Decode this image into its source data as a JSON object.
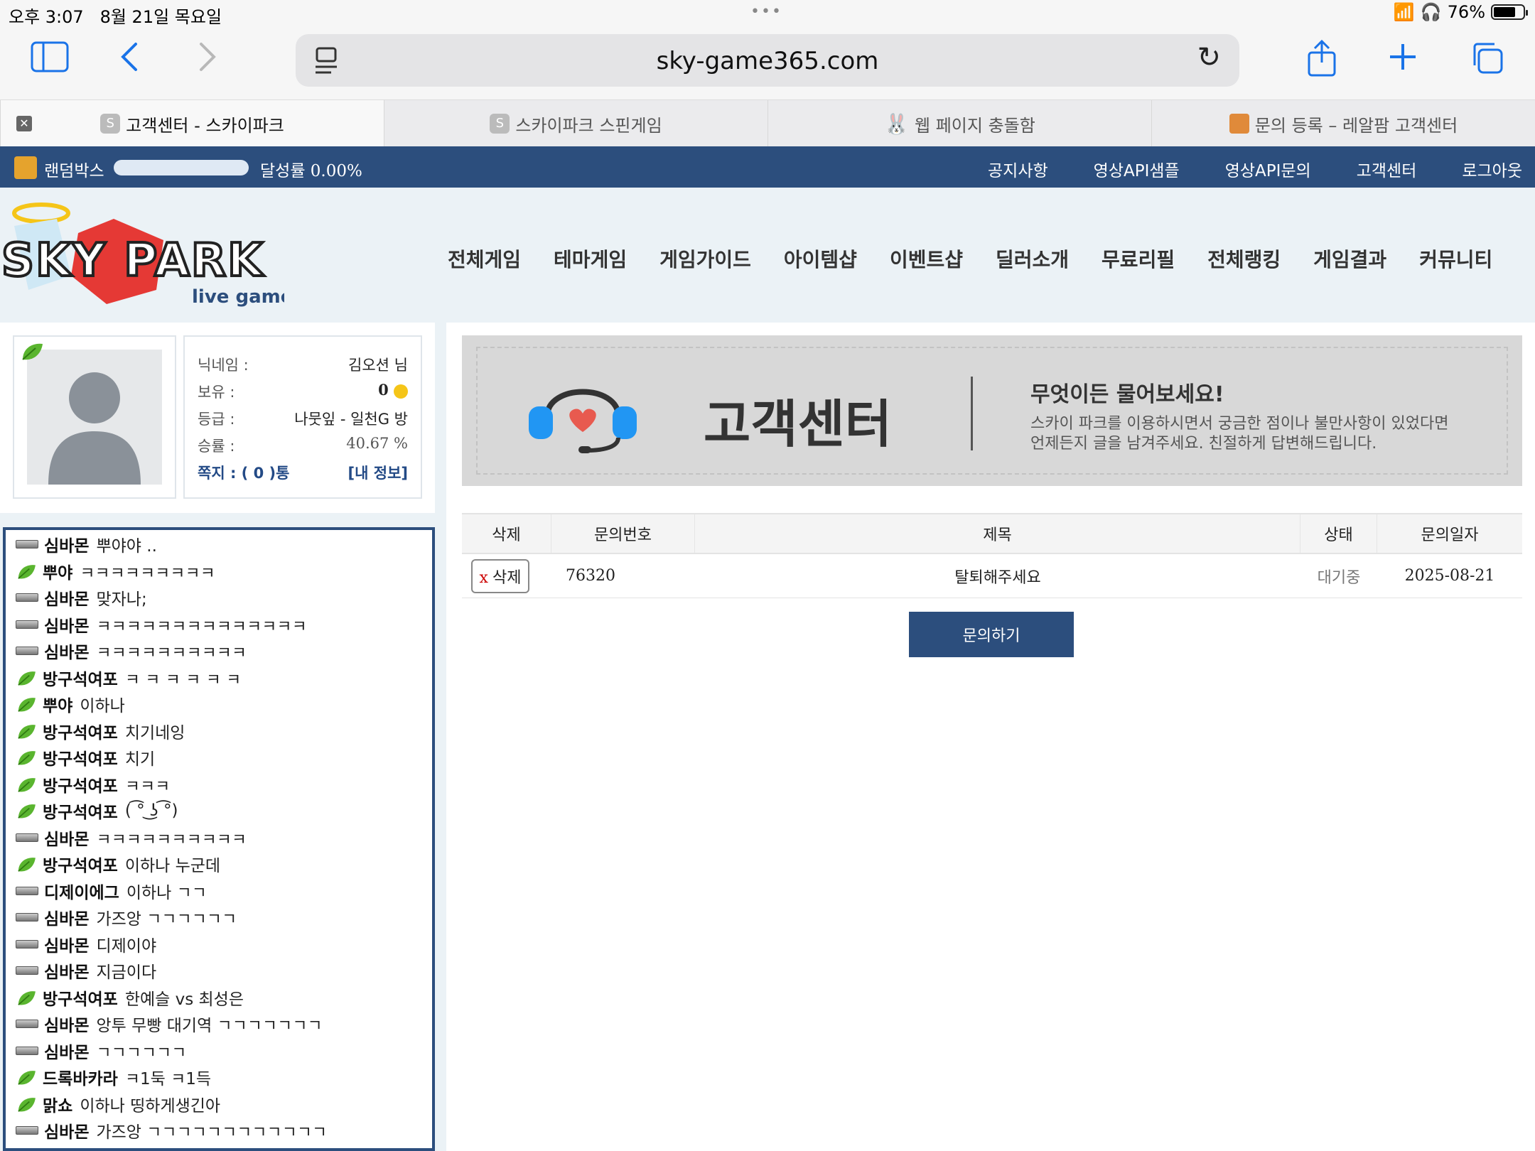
{
  "status_bar": {
    "time": "오후 3:07",
    "date": "8월 21일 목요일",
    "battery": "76%",
    "battery_level": 0.76
  },
  "browser": {
    "url": "sky-game365.com",
    "tabs": [
      {
        "title": "고객센터 - 스카이파크",
        "favicon": "S",
        "active": true
      },
      {
        "title": "스카이파크 스핀게임",
        "favicon": "S",
        "active": false
      },
      {
        "title": "웹 페이지 충돌함",
        "favicon": "",
        "active": false
      },
      {
        "title": "문의 등록 – 레알팜 고객센터",
        "favicon": "",
        "active": false
      }
    ]
  },
  "topbar": {
    "randombox_label": "랜덤박스",
    "progress": 0.0,
    "rate_label": "달성률 0.00%",
    "links": [
      "공지사항",
      "영상API샘플",
      "영상API문의",
      "고객센터",
      "로그아웃"
    ]
  },
  "logo": {
    "text": "SKY PARK",
    "subtitle": "live games"
  },
  "nav": [
    "전체게임",
    "테마게임",
    "게임가이드",
    "아이템샵",
    "이벤트샵",
    "딜러소개",
    "무료리필",
    "전체랭킹",
    "게임결과",
    "커뮤니티"
  ],
  "profile": {
    "nickname_label": "닉네임 :",
    "nickname": "김오션 님",
    "balance_label": "보유 :",
    "balance": "0",
    "grade_label": "등급 :",
    "grade": "나뭇잎 - 일천G 방",
    "winrate_label": "승률 :",
    "winrate": "40.67 %",
    "messages": "쪽지 : ( 0 )통",
    "myinfo": "[내 정보]"
  },
  "chat": [
    {
      "level": "bar",
      "nick": "심바몬",
      "msg": "뿌야야 .."
    },
    {
      "level": "leaf",
      "nick": "뿌야",
      "msg": "ㅋㅋㅋㅋㅋㅋㅋㅋㅋ"
    },
    {
      "level": "bar",
      "nick": "심바몬",
      "msg": "맞자나;"
    },
    {
      "level": "bar",
      "nick": "심바몬",
      "msg": "ㅋㅋㅋㅋㅋㅋㅋㅋㅋㅋㅋㅋㅋㅋ"
    },
    {
      "level": "bar",
      "nick": "심바몬",
      "msg": "ㅋㅋㅋㅋㅋㅋㅋㅋㅋㅋ"
    },
    {
      "level": "leaf",
      "nick": "방구석여포",
      "msg": "ㅋ ㅋ ㅋ ㅋ ㅋ ㅋ"
    },
    {
      "level": "leaf",
      "nick": "뿌야",
      "msg": "이하나"
    },
    {
      "level": "leaf",
      "nick": "방구석여포",
      "msg": "치기네잉"
    },
    {
      "level": "leaf",
      "nick": "방구석여포",
      "msg": "치기"
    },
    {
      "level": "leaf",
      "nick": "방구석여포",
      "msg": "ㅋㅋㅋ"
    },
    {
      "level": "leaf",
      "nick": "방구석여포",
      "msg": "( ͡° ͜ʖ ͡°)"
    },
    {
      "level": "bar",
      "nick": "심바몬",
      "msg": "ㅋㅋㅋㅋㅋㅋㅋㅋㅋㅋ"
    },
    {
      "level": "leaf",
      "nick": "방구석여포",
      "msg": "이하나 누군데"
    },
    {
      "level": "bar",
      "nick": "디제이에그",
      "msg": "이하나 ㄱㄱ"
    },
    {
      "level": "bar",
      "nick": "심바몬",
      "msg": "가즈앙 ㄱㄱㄱㄱㄱㄱ"
    },
    {
      "level": "bar",
      "nick": "심바몬",
      "msg": "디제이야"
    },
    {
      "level": "bar",
      "nick": "심바몬",
      "msg": "지금이다"
    },
    {
      "level": "leaf",
      "nick": "방구석여포",
      "msg": "한예슬 vs 최성은"
    },
    {
      "level": "bar",
      "nick": "심바몬",
      "msg": "앙투 무빵 대기역 ㄱㄱㄱㄱㄱㄱㄱ"
    },
    {
      "level": "bar",
      "nick": "심바몬",
      "msg": "ㄱㄱㄱㄱㄱㄱ"
    },
    {
      "level": "leaf",
      "nick": "드록바카라",
      "msg": "ㅋ1둑 ㅋ1득"
    },
    {
      "level": "leaf",
      "nick": "맑쇼",
      "msg": "이하나 띵하게생긴아"
    },
    {
      "level": "bar",
      "nick": "심바몬",
      "msg": "가즈앙 ㄱㄱㄱㄱㄱㄱㄱㄱㄱㄱㄱㄱ"
    }
  ],
  "banner": {
    "title": "고객센터",
    "headline": "무엇이든 물어보세요!",
    "line1": "스카이 파크를 이용하시면서 궁금한 점이나 불만사항이 있었다면",
    "line2": "언제든지 글을 남겨주세요. 친절하게 답변해드립니다."
  },
  "table": {
    "headers": [
      "삭제",
      "문의번호",
      "제목",
      "상태",
      "문의일자"
    ],
    "rows": [
      {
        "delete_x": "x",
        "delete_label": "삭제",
        "number": "76320",
        "subject": "탈퇴해주세요",
        "status": "대기중",
        "date": "2025-08-21"
      }
    ]
  },
  "ask_button": "문의하기",
  "colors": {
    "brand_blue": "#2c4e7d",
    "banner_gray": "#d8d8d8",
    "safari_blue": "#1a73e8"
  }
}
